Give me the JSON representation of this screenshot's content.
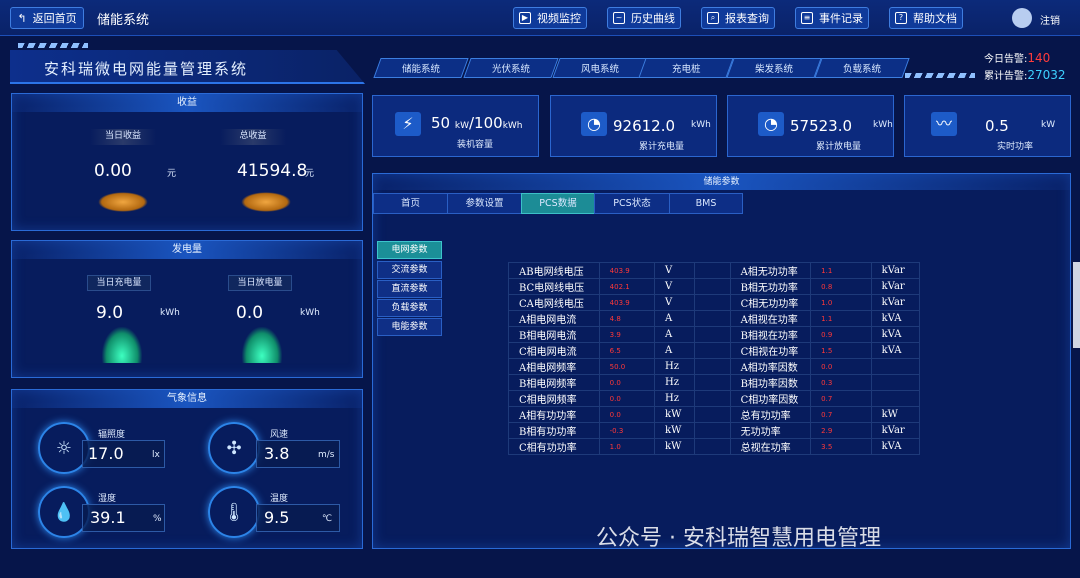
{
  "topbar": {
    "back": "返回首页",
    "title": "储能系统",
    "buttons": [
      "视频监控",
      "历史曲线",
      "报表查询",
      "事件记录",
      "帮助文档"
    ],
    "logout": "注销"
  },
  "system": {
    "title": "安科瑞微电网能量管理系统",
    "tabs": [
      "储能系统",
      "光伏系统",
      "风电系统",
      "充电桩",
      "柴发系统",
      "负载系统"
    ],
    "alarm_today_label": "今日告警:",
    "alarm_today": "140",
    "alarm_total_label": "累计告警:",
    "alarm_total": "27032"
  },
  "income": {
    "title": "收益",
    "today_label": "当日收益",
    "today": "0.00",
    "today_unit": "元",
    "total_label": "总收益",
    "total": "41594.8",
    "total_unit": "元"
  },
  "energy": {
    "title": "发电量",
    "charge_label": "当日充电量",
    "charge": "9.0",
    "charge_unit": "kWh",
    "discharge_label": "当日放电量",
    "discharge": "0.0",
    "discharge_unit": "kWh"
  },
  "weather": {
    "title": "气象信息",
    "items": [
      {
        "label": "辐照度",
        "value": "17.0",
        "unit": "lx"
      },
      {
        "label": "风速",
        "value": "3.8",
        "unit": "m/s"
      },
      {
        "label": "湿度",
        "value": "39.1",
        "unit": "%"
      },
      {
        "label": "温度",
        "value": "9.5",
        "unit": "℃"
      }
    ]
  },
  "cards": [
    {
      "value": "50",
      "unit1": "kW",
      "sep": "/100",
      "unit2": "kWh",
      "label": "装机容量"
    },
    {
      "value": "92612.0",
      "unit": "kWh",
      "label": "累计充电量"
    },
    {
      "value": "57523.0",
      "unit": "kWh",
      "label": "累计放电量"
    },
    {
      "value": "0.5",
      "unit": "kW",
      "label": "实时功率"
    }
  ],
  "params": {
    "title": "储能参数",
    "tabs": [
      "首页",
      "参数设置",
      "PCS数据",
      "PCS状态",
      "BMS"
    ],
    "menu": [
      "电网参数",
      "交流参数",
      "直流参数",
      "负载参数",
      "电能参数"
    ],
    "rows": [
      [
        "AB电网线电压",
        "403.9",
        "V",
        "A相无功功率",
        "1.1",
        "kVar"
      ],
      [
        "BC电网线电压",
        "402.1",
        "V",
        "B相无功功率",
        "0.8",
        "kVar"
      ],
      [
        "CA电网线电压",
        "403.9",
        "V",
        "C相无功功率",
        "1.0",
        "kVar"
      ],
      [
        "A相电网电流",
        "4.8",
        "A",
        "A相视在功率",
        "1.1",
        "kVA"
      ],
      [
        "B相电网电流",
        "3.9",
        "A",
        "B相视在功率",
        "0.9",
        "kVA"
      ],
      [
        "C相电网电流",
        "6.5",
        "A",
        "C相视在功率",
        "1.5",
        "kVA"
      ],
      [
        "A相电网频率",
        "50.0",
        "Hz",
        "A相功率因数",
        "0.0",
        ""
      ],
      [
        "B相电网频率",
        "0.0",
        "Hz",
        "B相功率因数",
        "0.3",
        ""
      ],
      [
        "C相电网频率",
        "0.0",
        "Hz",
        "C相功率因数",
        "0.7",
        ""
      ],
      [
        "A相有功功率",
        "0.0",
        "kW",
        "总有功功率",
        "0.7",
        "kW"
      ],
      [
        "B相有功功率",
        "-0.3",
        "kW",
        "无功功率",
        "2.9",
        "kVar"
      ],
      [
        "C相有功功率",
        "1.0",
        "kW",
        "总视在功率",
        "3.5",
        "kVA"
      ]
    ]
  },
  "watermark": "公众号 · 安科瑞智慧用电管理"
}
